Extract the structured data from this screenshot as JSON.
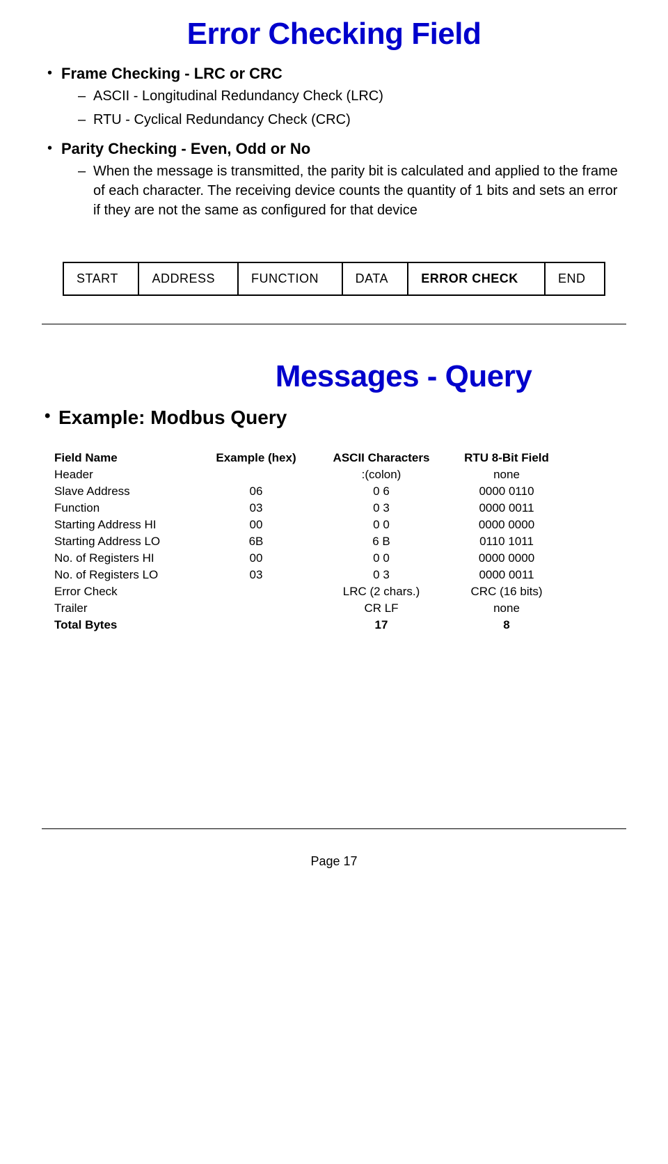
{
  "slide1": {
    "title": "Error Checking Field",
    "bullet1_head": "Frame Checking - LRC or CRC",
    "bullet1_sub1": "ASCII - Longitudinal Redundancy Check (LRC)",
    "bullet1_sub2": "RTU - Cyclical Redundancy Check (CRC)",
    "bullet2_head": "Parity Checking - Even, Odd or No",
    "bullet2_sub1": "When the message is transmitted, the parity bit is calculated and applied to the frame of each character. The receiving device counts the quantity of  1 bits and sets an error if they are not the same as configured for that device",
    "frame": {
      "start": "START",
      "address": "ADDRESS",
      "function": "FUNCTION",
      "data": "DATA",
      "error_check": "ERROR CHECK",
      "end": "END"
    }
  },
  "slide2": {
    "title": "Messages - Query",
    "example_head": "Example: Modbus Query",
    "headers": {
      "field_name": "Field Name",
      "example_hex": "Example (hex)",
      "ascii_chars": "ASCII Characters",
      "rtu_field": "RTU 8-Bit Field"
    },
    "rows": [
      {
        "name": "Header",
        "hex": "",
        "ascii": ":(colon)",
        "rtu": "none"
      },
      {
        "name": "Slave Address",
        "hex": "06",
        "ascii": "0 6",
        "rtu": "0000 0110"
      },
      {
        "name": "Function",
        "hex": "03",
        "ascii": "0 3",
        "rtu": "0000 0011"
      },
      {
        "name": "Starting Address HI",
        "hex": "00",
        "ascii": "0 0",
        "rtu": "0000 0000"
      },
      {
        "name": "Starting Address LO",
        "hex": "6B",
        "ascii": "6 B",
        "rtu": "0110 1011"
      },
      {
        "name": "No. of Registers HI",
        "hex": "00",
        "ascii": "0 0",
        "rtu": "0000 0000"
      },
      {
        "name": "No. of Registers LO",
        "hex": "03",
        "ascii": "0 3",
        "rtu": "0000 0011"
      },
      {
        "name": "Error Check",
        "hex": "",
        "ascii": "LRC (2 chars.)",
        "rtu": "CRC (16 bits)"
      },
      {
        "name": "Trailer",
        "hex": "",
        "ascii": "CR LF",
        "rtu": "none"
      },
      {
        "name": "Total Bytes",
        "hex": "",
        "ascii": "17",
        "rtu": "8"
      }
    ]
  },
  "page_label": "Page 17"
}
